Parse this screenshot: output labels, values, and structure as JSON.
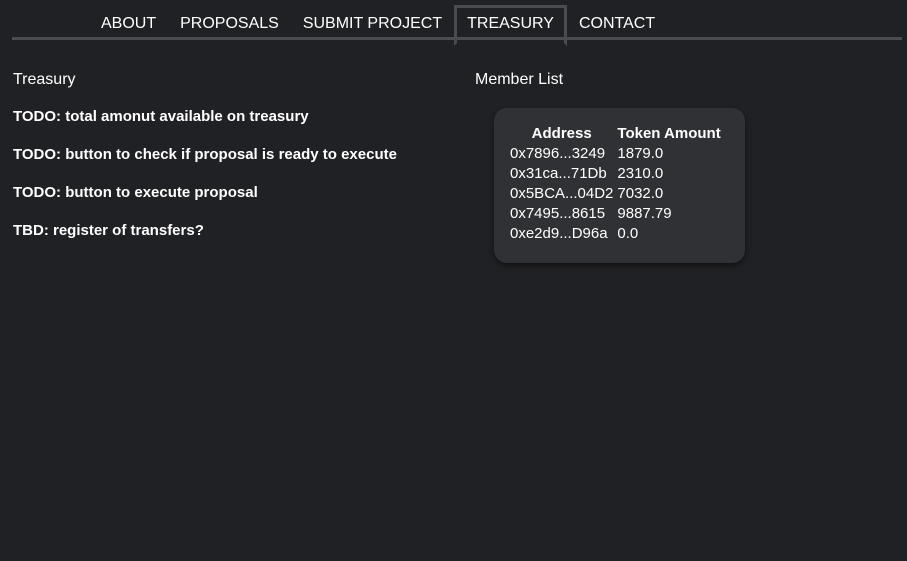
{
  "nav": {
    "tabs": [
      {
        "label": "ABOUT",
        "active": false
      },
      {
        "label": "PROPOSALS",
        "active": false
      },
      {
        "label": "SUBMIT PROJECT",
        "active": false
      },
      {
        "label": "TREASURY",
        "active": true
      },
      {
        "label": "CONTACT",
        "active": false
      }
    ]
  },
  "treasury": {
    "title": "Treasury",
    "items": [
      "TODO: total amonut available on treasury",
      "TODO: button to check if proposal is ready to execute",
      "TODO: button to execute proposal",
      "TBD: register of transfers?"
    ]
  },
  "members": {
    "title": "Member List",
    "columns": [
      "Address",
      "Token Amount"
    ],
    "rows": [
      {
        "address": "0x7896...3249",
        "amount": "1879.0"
      },
      {
        "address": "0x31ca...71Db",
        "amount": "2310.0"
      },
      {
        "address": "0x5BCA...04D2",
        "amount": "7032.0"
      },
      {
        "address": "0x7495...8615",
        "amount": "9887.79"
      },
      {
        "address": "0xe2d9...D96a",
        "amount": "0.0"
      }
    ]
  },
  "colors": {
    "background": "#202124",
    "card": "#303134",
    "tab_border": "#4a4b4f",
    "text": "#ffffff"
  }
}
